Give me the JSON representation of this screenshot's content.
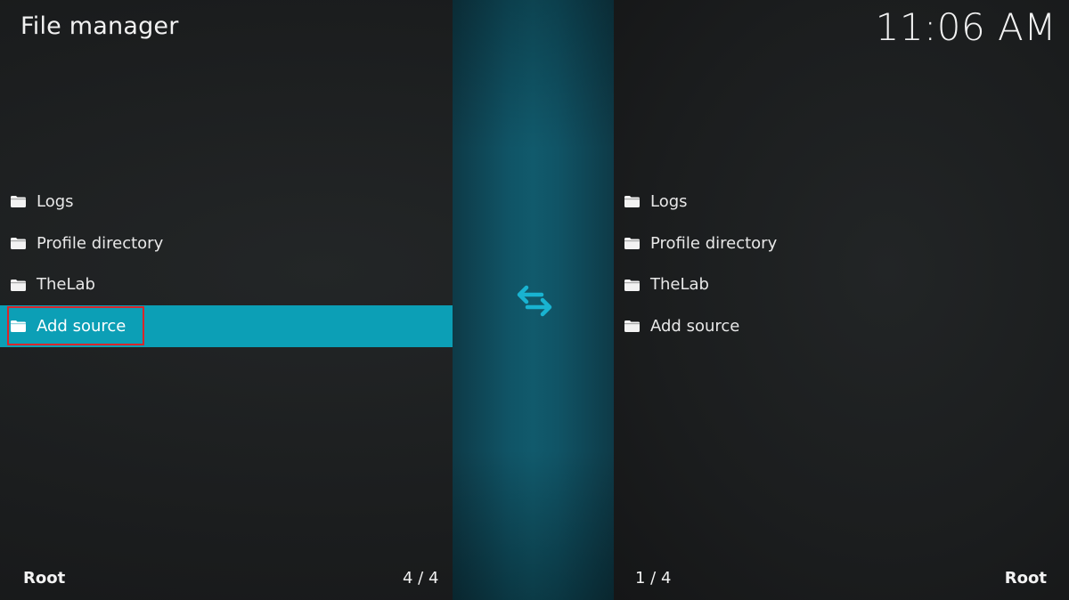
{
  "header": {
    "title": "File manager",
    "clock": "11:06 AM"
  },
  "left_pane": {
    "items": [
      {
        "label": "Logs",
        "icon": "folder-icon"
      },
      {
        "label": "Profile directory",
        "icon": "folder-icon"
      },
      {
        "label": "TheLab",
        "icon": "folder-icon"
      },
      {
        "label": "Add source",
        "icon": "folder-icon",
        "selected": true
      }
    ],
    "path": "Root",
    "count": "4 / 4"
  },
  "right_pane": {
    "items": [
      {
        "label": "Logs",
        "icon": "folder-icon"
      },
      {
        "label": "Profile directory",
        "icon": "folder-icon"
      },
      {
        "label": "TheLab",
        "icon": "folder-icon"
      },
      {
        "label": "Add source",
        "icon": "folder-icon"
      }
    ],
    "path": "Root",
    "count": "1 / 4"
  },
  "center": {
    "icon": "swap-arrows-icon"
  },
  "colors": {
    "accent": "#0c9fb6",
    "highlight_border": "#d9262b",
    "background": "#1b1d1e",
    "center_strip": "#115a6c"
  }
}
